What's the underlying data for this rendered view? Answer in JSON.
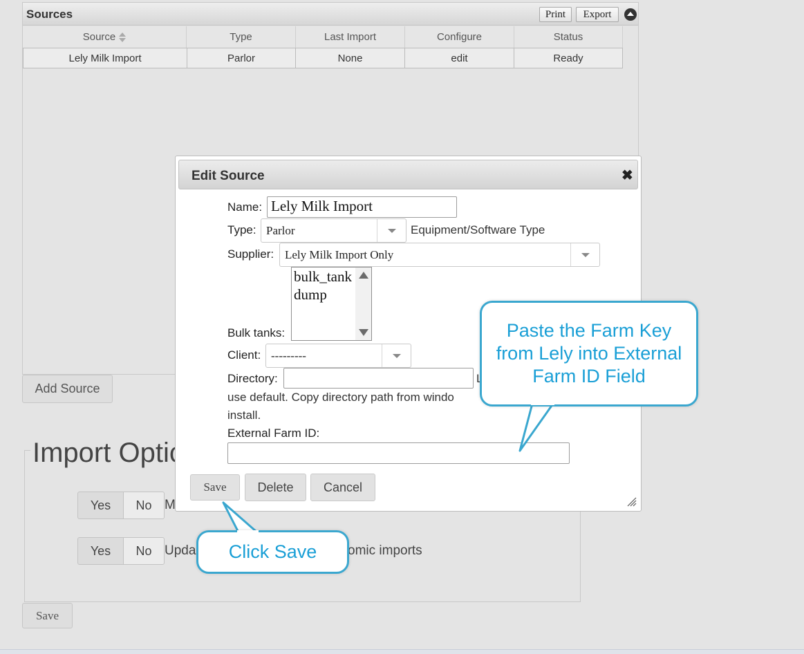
{
  "sources": {
    "title": "Sources",
    "print_label": "Print",
    "export_label": "Export",
    "columns": [
      "Source",
      "Type",
      "Last Import",
      "Configure",
      "Status"
    ],
    "rows": [
      {
        "source": "Lely Milk Import",
        "type": "Parlor",
        "last_import": "None",
        "configure": "edit",
        "status": "Ready"
      }
    ],
    "add_source_label": "Add Source"
  },
  "import_options": {
    "legend": "Import Optic",
    "options": [
      {
        "yes": "Yes",
        "no": "No",
        "text": "M"
      },
      {
        "yes": "Yes",
        "no": "No",
        "text": "Upda",
        "text_tail": "omic imports"
      }
    ],
    "save_label": "Save"
  },
  "dialog": {
    "title": "Edit Source",
    "name_label": "Name:",
    "name_value": "Lely Milk Import",
    "type_label": "Type:",
    "type_value": "Parlor",
    "type_hint": "Equipment/Software Type",
    "supplier_label": "Supplier:",
    "supplier_value": "Lely Milk Import Only",
    "bulk_tanks_label": "Bulk tanks:",
    "bulk_tanks_options": [
      "bulk_tank",
      "dump"
    ],
    "client_label": "Client:",
    "client_value": "---------",
    "directory_label": "Directory:",
    "directory_value": "",
    "directory_hint_tail": "L",
    "directory_help_line1": "use default. Copy directory path from windo",
    "directory_help_line2": "install.",
    "external_farm_id_label": "External Farm ID:",
    "external_farm_id_value": "",
    "save_label": "Save",
    "delete_label": "Delete",
    "cancel_label": "Cancel"
  },
  "callouts": {
    "farm_key": "Paste the Farm Key from Lely into External Farm ID Field",
    "click_save": "Click Save"
  },
  "colors": {
    "callout_border": "#3aa7cf",
    "callout_text": "#1a9fd6",
    "page_background": "#e4e4e4"
  }
}
